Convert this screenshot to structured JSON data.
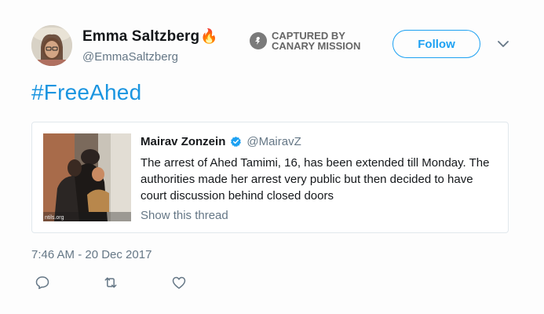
{
  "author": {
    "display_name": "Emma Saltzberg",
    "emoji": "🔥",
    "handle": "@EmmaSaltzberg"
  },
  "watermark": {
    "line1": "CAPTURED BY",
    "line2": "CANARY MISSION"
  },
  "follow_button": {
    "label": "Follow"
  },
  "tweet": {
    "text": "#FreeAhed"
  },
  "quoted_tweet": {
    "name": "Mairav Zonzein",
    "handle": "@MairavZ",
    "text": "The arrest of Ahed Tamimi, 16, has been extended till Monday. The authorities made her arrest very public but then decided to have court discussion behind closed doors",
    "show_thread": "Show this thread",
    "image_caption": "ntils.org"
  },
  "timestamp": "7:46 AM - 20 Dec 2017",
  "colors": {
    "accent": "#1da1f2",
    "hashtag": "#1b95e0",
    "muted": "#657786",
    "border": "#e1e8ed"
  },
  "icons": [
    "reply-icon",
    "retweet-icon",
    "like-icon",
    "chevron-down-icon",
    "verified-icon",
    "canary-icon"
  ]
}
